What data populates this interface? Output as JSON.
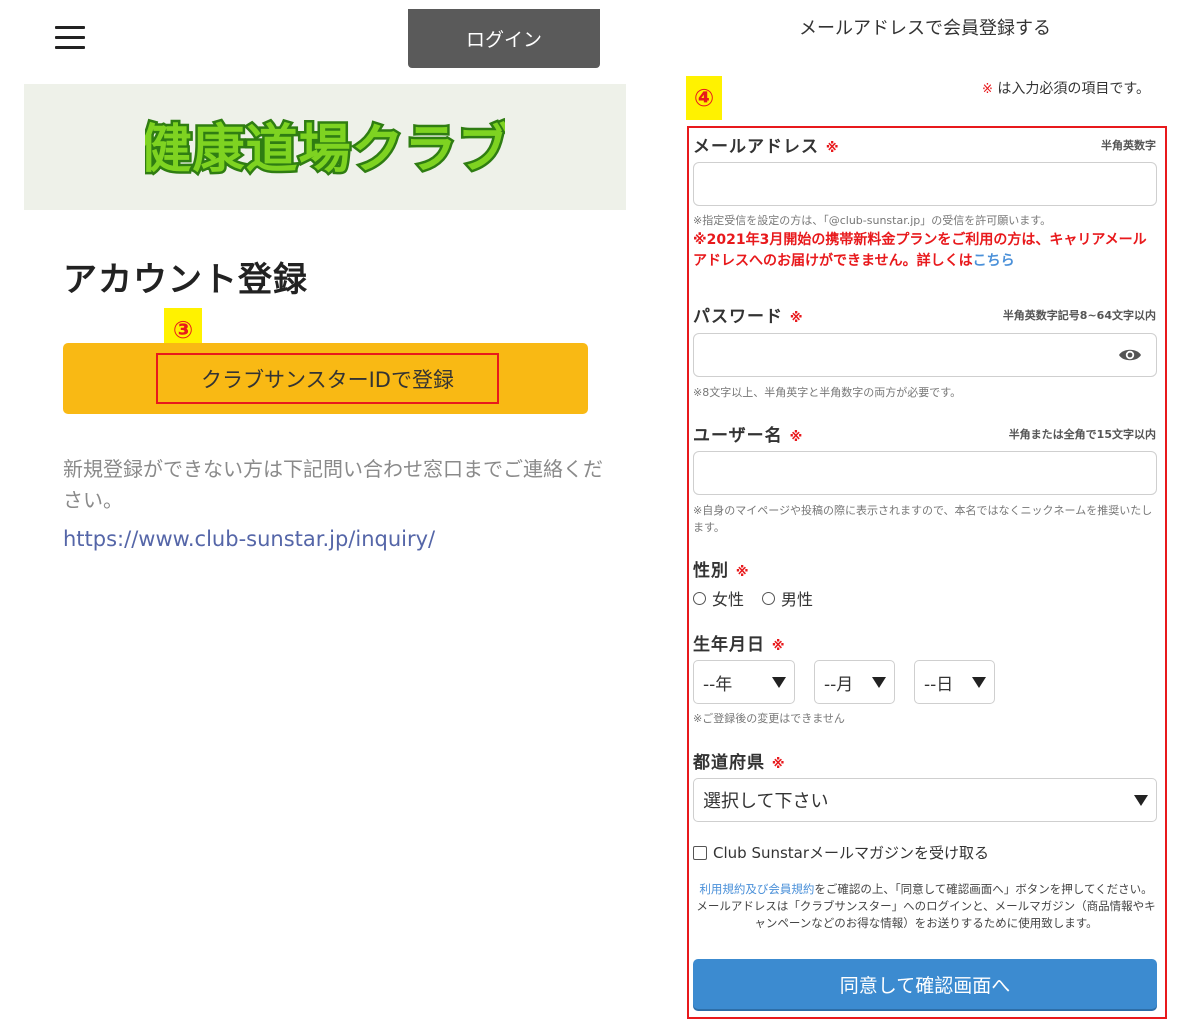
{
  "header": {
    "menu_icon": "hamburger-menu-icon",
    "login_label": "ログイン"
  },
  "banner": {
    "logo_text": "健康道場クラブ",
    "logo_colors": {
      "fill": "#7ed321",
      "stroke": "#2f7d12"
    }
  },
  "account": {
    "title": "アカウント登録",
    "badge": "③",
    "sunstar_button_label": "クラブサンスターIDで登録",
    "notice": "新規登録ができない方は下記問い合わせ窓口までご連絡ください。",
    "inquiry_link": "https://www.club-sunstar.jp/inquiry/"
  },
  "form": {
    "heading": "メールアドレスで会員登録する",
    "badge": "④",
    "required_mark": "※",
    "required_note": "は入力必須の項目です。",
    "email": {
      "label": "メールアドレス",
      "hint": "半角英数字",
      "note": "※指定受信を設定の方は、「@club-sunstar.jp」の受信を許可願います。",
      "warning": "※2021年3月開始の携帯新料金プランをご利用の方は、キャリアメールアドレスへのお届けができません。詳しくは",
      "warning_link": "こちら"
    },
    "password": {
      "label": "パスワード",
      "hint": "半角英数字記号8~64文字以内",
      "note": "※8文字以上、半角英字と半角数字の両方が必要です。",
      "toggle_icon": "eye-icon"
    },
    "username": {
      "label": "ユーザー名",
      "hint": "半角または全角で15文字以内",
      "note": "※自身のマイページや投稿の際に表示されますので、本名ではなくニックネームを推奨いたします。"
    },
    "gender": {
      "label": "性別",
      "options": [
        "女性",
        "男性"
      ]
    },
    "birthdate": {
      "label": "生年月日",
      "year": "--年",
      "month": "--月",
      "day": "--日",
      "note": "※ご登録後の変更はできません"
    },
    "prefecture": {
      "label": "都道府県",
      "placeholder": "選択して下さい"
    },
    "newsletter_label": "Club Sunstarメールマガジンを受け取る",
    "terms": {
      "link": "利用規約及び会員規約",
      "text1": "をご確認の上、「同意して確認画面へ」ボタンを押してください。",
      "text2": "メールアドレスは「クラブサンスター」へのログインと、メールマガジン（商品情報やキャンペーンなどのお得な情報）をお送りするために使用致します。"
    },
    "submit_label": "同意して確認画面へ"
  },
  "colors": {
    "login_bg": "#5a5a5a",
    "sunstar_btn": "#f9b914",
    "highlight_red": "#e8191c",
    "badge_yellow": "#fff200",
    "submit_blue": "#3c8bd0",
    "link_blue": "#4a90d9"
  }
}
